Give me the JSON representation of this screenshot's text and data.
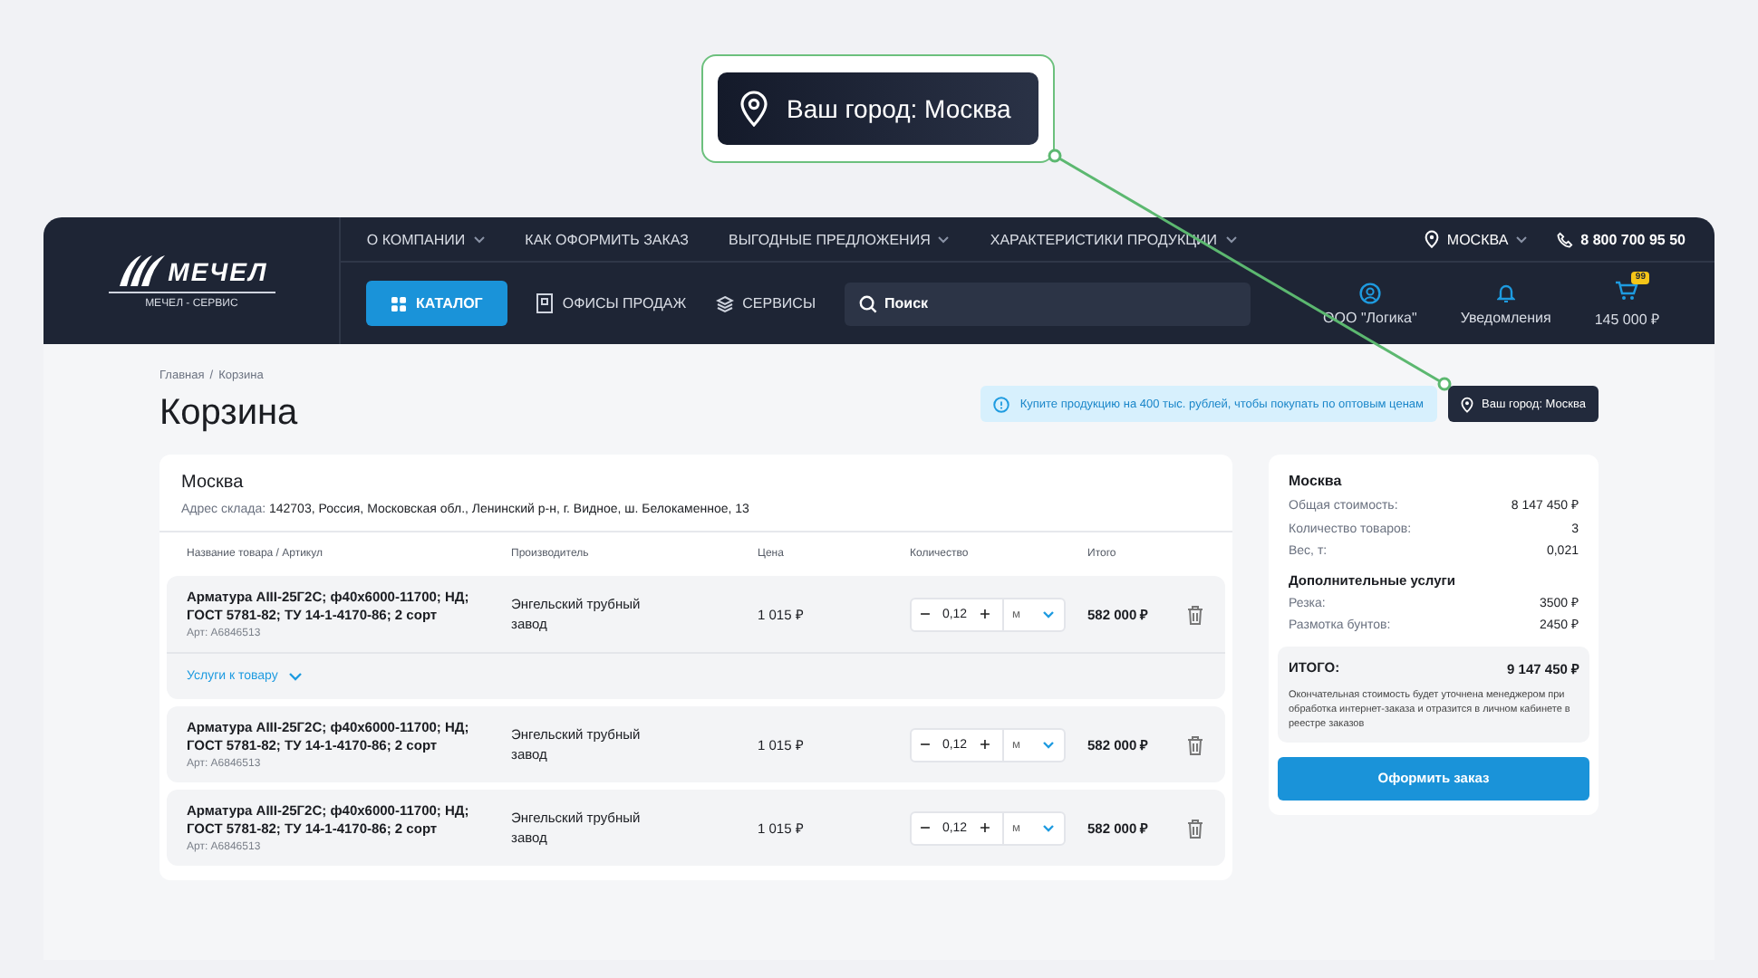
{
  "callout": {
    "label": "Ваш город: Москва"
  },
  "header": {
    "logo": {
      "title": "МЕЧЕЛ",
      "subtitle": "МЕЧЕЛ - СЕРВИС"
    },
    "top_nav": [
      {
        "label": "О КОМПАНИИ",
        "has_dropdown": true
      },
      {
        "label": "КАК ОФОРМИТЬ ЗАКАЗ",
        "has_dropdown": false
      },
      {
        "label": "ВЫГОДНЫЕ ПРЕДЛОЖЕНИЯ",
        "has_dropdown": true
      },
      {
        "label": "ХАРАКТЕРИСТИКИ ПРОДУКЦИИ",
        "has_dropdown": true
      }
    ],
    "location": "МОСКВА",
    "phone": "8 800 700 95 50",
    "catalog_button": "КАТАЛОГ",
    "nav_links": [
      {
        "label": "ОФИСЫ ПРОДАЖ",
        "kind": "offices"
      },
      {
        "label": "СЕРВИСЫ",
        "kind": "services"
      }
    ],
    "search": {
      "placeholder": "Поиск"
    },
    "user_items": [
      {
        "label": "ООО \"Логика\"",
        "kind": "profile"
      },
      {
        "label": "Уведомления",
        "kind": "notifications"
      },
      {
        "label": "145 000 ₽",
        "kind": "cart",
        "badge": "99"
      }
    ]
  },
  "breadcrumbs": [
    "Главная",
    "Корзина"
  ],
  "breadcrumb_separator": "/",
  "title": "Корзина",
  "notice": "Купите продукцию на 400 тыс. рублей, чтобы покупать по оптовым ценам",
  "city_button": "Ваш город: Москва",
  "cart": {
    "city": "Москва",
    "address_label": "Адрес склада:",
    "address": "142703, Россия, Московская обл., Ленинский р-н, г. Видное, ш. Белокаменное, 13",
    "columns": [
      "Название товара / Артикул",
      "Производитель",
      "Цена",
      "Количество",
      "Итого"
    ],
    "rows": [
      {
        "name": "Арматура AIII-25Г2С; ф40х6000-11700; НД; ГОСТ 5781-82; ТУ 14-1-4170-86; 2 сорт",
        "article": "Арт: А6846513",
        "manufacturer": "Энгельский трубный завод",
        "price": "1 015 ₽",
        "quantity": "0,12",
        "unit": "м",
        "total": "582 000 ₽",
        "services_link": "Услуги к товару",
        "expanded": false
      },
      {
        "name": "Арматура AIII-25Г2С; ф40х6000-11700; НД; ГОСТ 5781-82; ТУ 14-1-4170-86; 2 сорт",
        "article": "Арт: А6846513",
        "manufacturer": "Энгельский трубный завод",
        "price": "1 015 ₽",
        "quantity": "0,12",
        "unit": "м",
        "total": "582 000 ₽"
      },
      {
        "name": "Арматура AIII-25Г2С; ф40х6000-11700; НД; ГОСТ 5781-82; ТУ 14-1-4170-86; 2 сорт",
        "article": "Арт: А6846513",
        "manufacturer": "Энгельский трубный завод",
        "price": "1 015 ₽",
        "quantity": "0,12",
        "unit": "м",
        "total": "582 000 ₽"
      }
    ]
  },
  "summary": {
    "city": "Москва",
    "lines": [
      {
        "label": "Общая стоимость:",
        "value": "8 147 450 ₽"
      },
      {
        "label": "Количество товаров:",
        "value": "3"
      },
      {
        "label": "Вес, т:",
        "value": "0,021"
      }
    ],
    "services_title": "Дополнительные услуги",
    "services": [
      {
        "label": "Резка:",
        "value": "3500 ₽"
      },
      {
        "label": "Размотка бунтов:",
        "value": "2450 ₽"
      }
    ],
    "total_label": "ИТОГО:",
    "total_value": "9 147 450 ₽",
    "note": "Окончательная стоимость будет уточнена менеджером при обработка интернет-заказа и отразится в личном кабинете в реестре заказов",
    "order_button": "Оформить заказ"
  }
}
